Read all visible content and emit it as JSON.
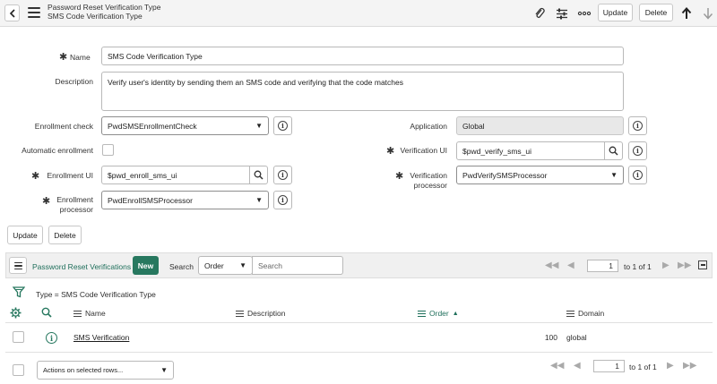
{
  "header": {
    "title": "Password Reset Verification Type",
    "subtitle": "SMS Code Verification Type",
    "update_label": "Update",
    "delete_label": "Delete"
  },
  "form": {
    "name_label": "Name",
    "name_value": "SMS Code Verification Type",
    "description_label": "Description",
    "description_value": "Verify user's identity by sending them an SMS code and verifying that the code matches",
    "enrollment_check_label": "Enrollment check",
    "enrollment_check_value": "PwdSMSEnrollmentCheck",
    "application_label": "Application",
    "application_value": "Global",
    "automatic_enrollment_label": "Automatic enrollment",
    "verification_ui_label": "Verification UI",
    "verification_ui_value": "$pwd_verify_sms_ui",
    "enrollment_ui_label": "Enrollment UI",
    "enrollment_ui_value": "$pwd_enroll_sms_ui",
    "verification_processor_label_1": "Verification",
    "verification_processor_label_2": "processor",
    "verification_processor_value": "PwdVerifySMSProcessor",
    "enrollment_processor_label_1": "Enrollment",
    "enrollment_processor_label_2": "processor",
    "enrollment_processor_value": "PwdEnrollSMSProcessor",
    "update_label": "Update",
    "delete_label": "Delete"
  },
  "related_list": {
    "title": "Password Reset Verifications",
    "new_label": "New",
    "search_label": "Search",
    "search_field": "Order",
    "search_placeholder": "Search",
    "page_value": "1",
    "page_of": "to 1 of 1",
    "filter_text": "Type = SMS Code Verification Type",
    "columns": {
      "name": "Name",
      "description": "Description",
      "order": "Order",
      "order_sort": "▲",
      "domain": "Domain"
    },
    "rows": [
      {
        "name": "SMS Verification",
        "order": "100",
        "domain": "global"
      }
    ],
    "actions_label": "Actions on selected rows..."
  },
  "colors": {
    "accent": "#27785f",
    "link": "#1f6f5b"
  }
}
